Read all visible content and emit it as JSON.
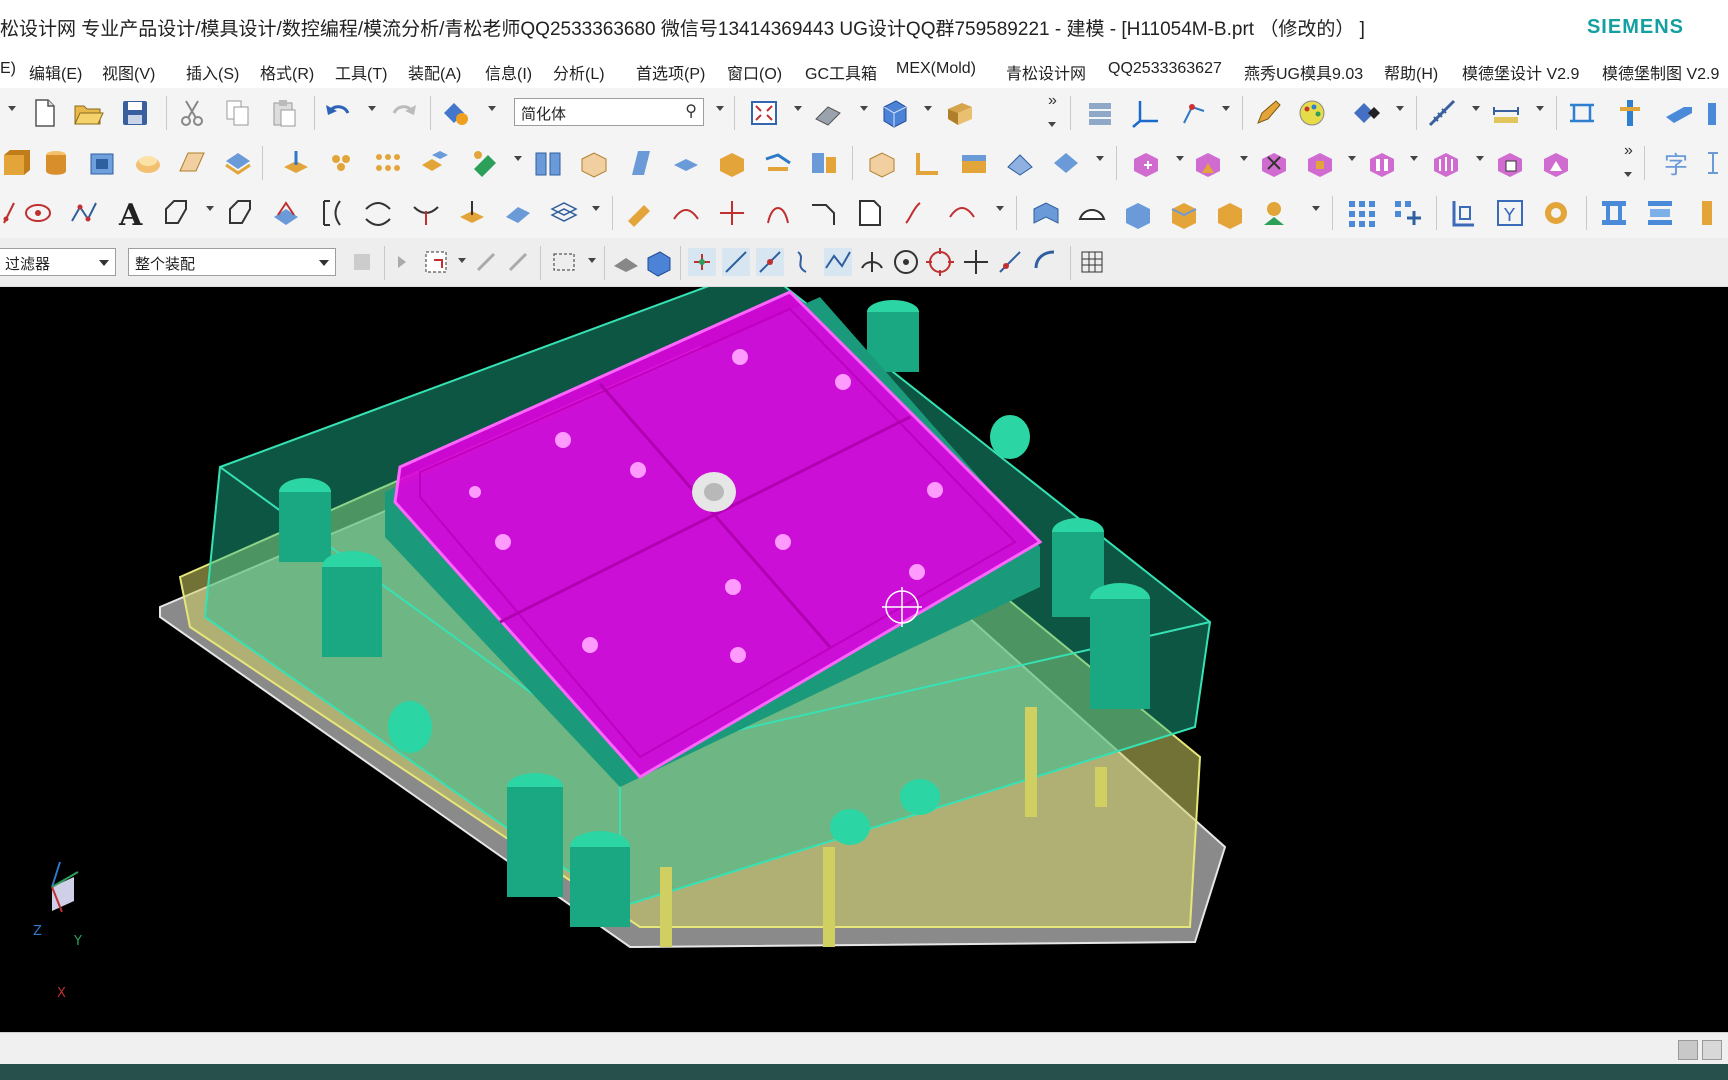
{
  "window": {
    "title": "松设计网 专业产品设计/模具设计/数控编程/模流分析/青松老师QQ2533363680 微信号13414369443 UG设计QQ群759589221 - 建模 - [H11054M-B.prt （修改的） ]",
    "brand": "SIEMENS"
  },
  "menu": {
    "items": [
      "E)",
      "编辑(E)",
      "视图(V)",
      "插入(S)",
      "格式(R)",
      "工具(T)",
      "装配(A)",
      "信息(I)",
      "分析(L)",
      "首选项(P)",
      "窗口(O)",
      "GC工具箱",
      "MEX(Mold)",
      "青松设计网",
      "QQ2533363627",
      "燕秀UG模具9.03",
      "帮助(H)",
      "模德堡设计 V2.9",
      "模德堡制图 V2.9"
    ]
  },
  "toolbar": {
    "rendering_style": "简化体",
    "type_filter": "过滤器",
    "selection_scope": "整个装配",
    "more_glyph": "»"
  },
  "viewport": {
    "background": "#000000",
    "part_color": "#e000e0",
    "plate_color": "#1fbf96",
    "clamp_color": "#cfcf62"
  },
  "triad": {
    "z": "Z",
    "y": "Y",
    "x": "X"
  },
  "colors": {
    "brand": "#14a0a0"
  }
}
